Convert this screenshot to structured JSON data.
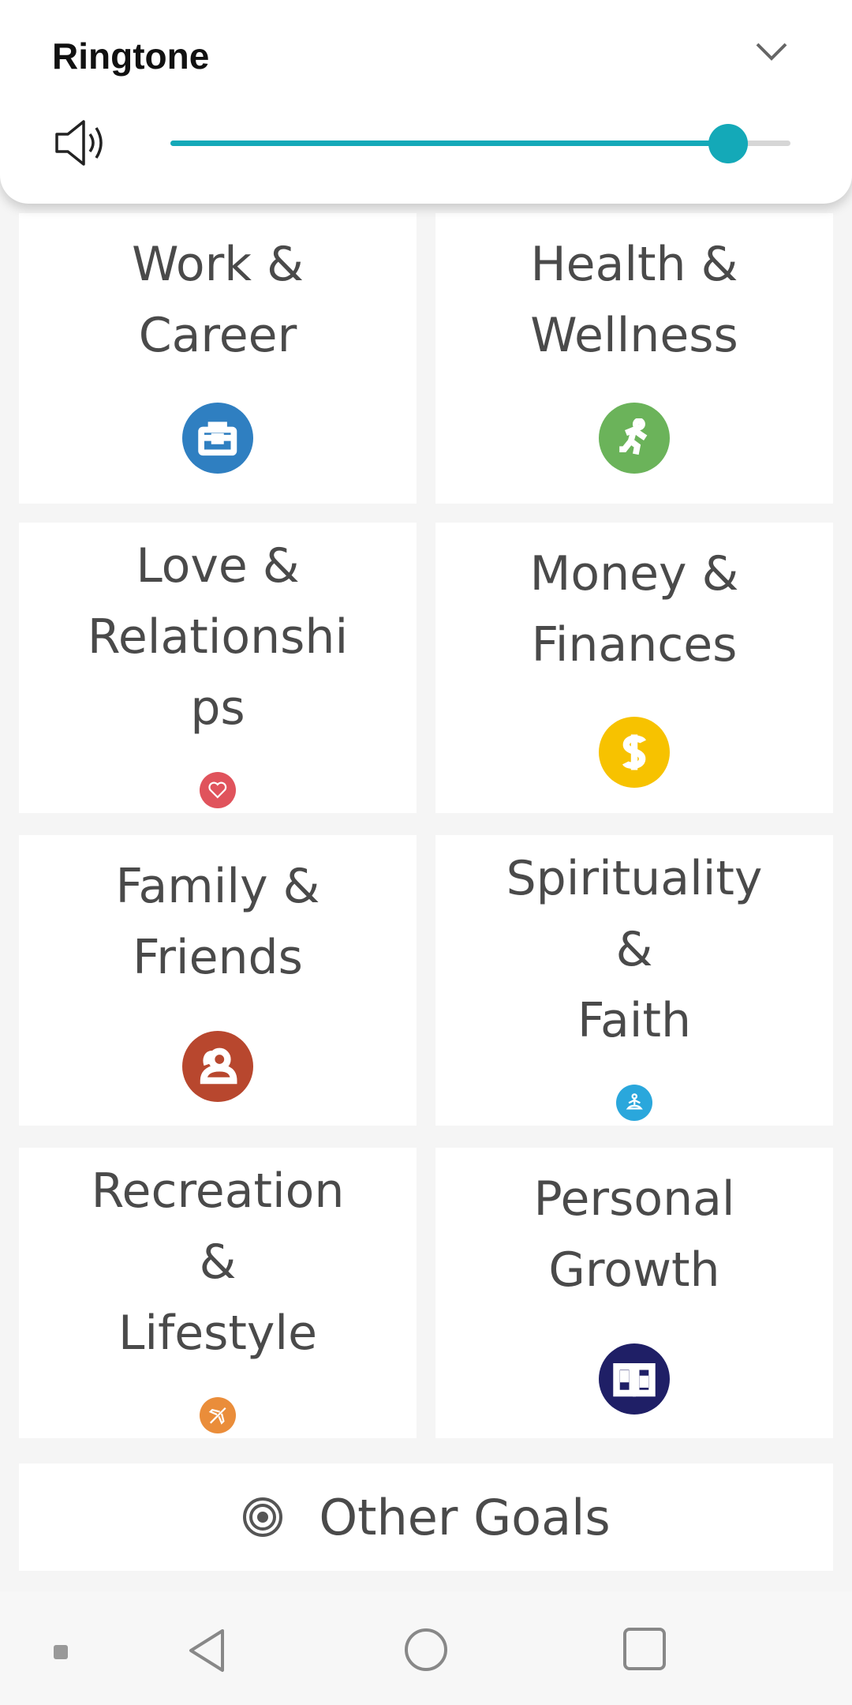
{
  "volume_panel": {
    "title": "Ringtone",
    "level_percent": 90,
    "icons": {
      "speaker": "speaker-icon",
      "collapse": "chevron-down-icon"
    }
  },
  "categories": [
    {
      "label": "Work &\nCareer",
      "icon": "briefcase-icon",
      "color": "#2f7fc1"
    },
    {
      "label": "Health &\nWellness",
      "icon": "runner-icon",
      "color": "#6bb35a"
    },
    {
      "label": "Love &\nRelationshi\nps",
      "icon": "heart-icon",
      "color": "#e0535c"
    },
    {
      "label": "Money &\nFinances",
      "icon": "dollar-icon",
      "color": "#f7c200"
    },
    {
      "label": "Family &\nFriends",
      "icon": "people-icon",
      "color": "#b8472e"
    },
    {
      "label": "Spirituality\n&\nFaith",
      "icon": "meditation-icon",
      "color": "#2aa7dc"
    },
    {
      "label": "Recreation\n&\nLifestyle",
      "icon": "airplane-icon",
      "color": "#ea8d3a"
    },
    {
      "label": "Personal\nGrowth",
      "icon": "book-icon",
      "color": "#1f1f66"
    }
  ],
  "other_goals": {
    "label": "Other Goals",
    "icon": "target-icon"
  },
  "navbar": {
    "icons": [
      "dot-icon",
      "back-icon",
      "home-icon",
      "recents-icon"
    ]
  }
}
